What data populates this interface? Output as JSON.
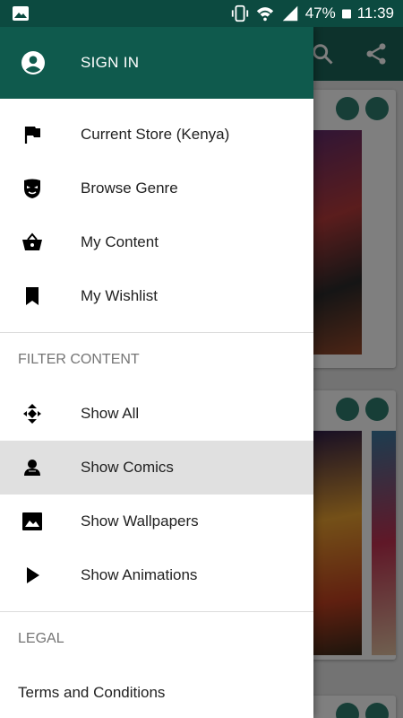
{
  "status_bar": {
    "battery_percent": "47%",
    "time": "11:39"
  },
  "drawer": {
    "header": {
      "sign_in_label": "SIGN IN"
    },
    "nav_items": [
      {
        "label": "Current Store (Kenya)",
        "icon": "flag-icon"
      },
      {
        "label": "Browse Genre",
        "icon": "mask-icon"
      },
      {
        "label": "My Content",
        "icon": "basket-icon"
      },
      {
        "label": "My Wishlist",
        "icon": "bookmark-icon"
      }
    ],
    "filter_section": {
      "title": "FILTER CONTENT",
      "items": [
        {
          "label": "Show All",
          "icon": "show-all-icon",
          "selected": false
        },
        {
          "label": "Show Comics",
          "icon": "comics-icon",
          "selected": true
        },
        {
          "label": "Show Wallpapers",
          "icon": "image-icon",
          "selected": false
        },
        {
          "label": "Show Animations",
          "icon": "play-icon",
          "selected": false
        }
      ]
    },
    "legal_section": {
      "title": "LEGAL",
      "items": [
        {
          "label": "Terms and Conditions"
        }
      ]
    }
  },
  "colors": {
    "status_bar": "#0c4a40",
    "drawer_header": "#0f5a4d",
    "selected_item": "#e0e0e0",
    "accent": "#2e7d6e"
  }
}
